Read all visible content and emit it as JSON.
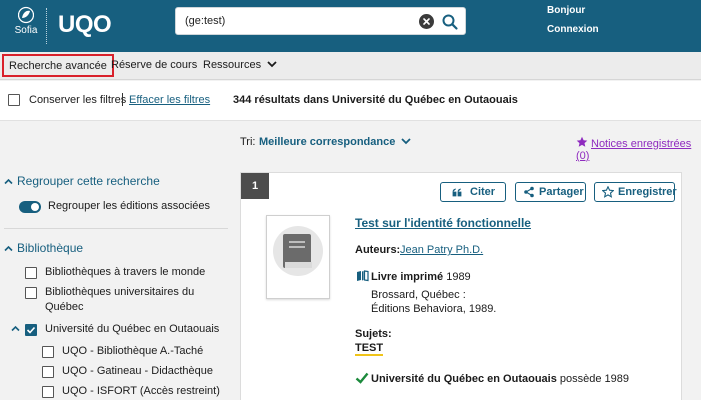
{
  "header": {
    "sofia_label": "Sofia",
    "logo": "UQO",
    "search_value": "(ge:test)",
    "greeting": "Bonjour",
    "login": "Connexion"
  },
  "nav": {
    "advanced": "Recherche avancée",
    "reserve": "Réserve de cours",
    "resources": "Ressources"
  },
  "filters": {
    "keep": "Conserver les filtres",
    "clear": "Effacer les filtres",
    "results": "344 résultats dans Université du Québec en Outaouais"
  },
  "sidebar": {
    "group_head": "Regrouper cette recherche",
    "group_toggle": "Regrouper les éditions associées",
    "library_head": "Bibliothèque",
    "items": [
      "Bibliothèques à travers le monde",
      "Bibliothèques universitaires du",
      "Québec",
      "Université du Québec en Outaouais",
      "UQO - Bibliothèque A.-Taché",
      "UQO - Gatineau - Didacthèque",
      "UQO - ISFORT (Accès restreint)"
    ]
  },
  "sort": {
    "label": "Tri:",
    "value": "Meilleure correspondance"
  },
  "saved": "Notices enregistrées (0)",
  "result": {
    "number": "1",
    "cite": "Citer",
    "share": "Partager",
    "save": "Enregistrer",
    "title": "Test sur l'identité fonctionnelle",
    "authors_label": "Auteurs:",
    "author": "Jean Patry Ph.D.",
    "format": "Livre imprimé",
    "year": "1989",
    "pub_place": "Brossard, Québec :",
    "pub_name": "Éditions Behaviora, 1989.",
    "subjects_label": "Sujets:",
    "subject": "TEST",
    "holding_lib": "Université du Québec en Outaouais",
    "holding_text": " possède 1989"
  },
  "colors": {
    "brand": "#175f7f",
    "highlight": "#d9212b",
    "saved": "#8f2bbf"
  }
}
